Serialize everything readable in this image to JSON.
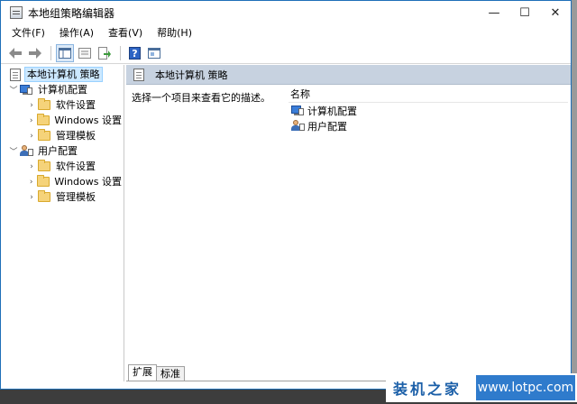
{
  "window": {
    "title": "本地组策略编辑器"
  },
  "menu": [
    {
      "label": "文件(F)"
    },
    {
      "label": "操作(A)"
    },
    {
      "label": "查看(V)"
    },
    {
      "label": "帮助(H)"
    }
  ],
  "tree": {
    "root": "本地计算机 策略",
    "computer": {
      "label": "计算机配置",
      "children": [
        "软件设置",
        "Windows 设置",
        "管理模板"
      ]
    },
    "user": {
      "label": "用户配置",
      "children": [
        "软件设置",
        "Windows 设置",
        "管理模板"
      ]
    }
  },
  "pane": {
    "header": "本地计算机 策略",
    "description": "选择一个项目来查看它的描述。",
    "column_name": "名称",
    "items": [
      "计算机配置",
      "用户配置"
    ]
  },
  "tabs": [
    "扩展",
    "标准"
  ],
  "watermark": {
    "text": "装机之家",
    "url": "www.lotpc.com"
  }
}
